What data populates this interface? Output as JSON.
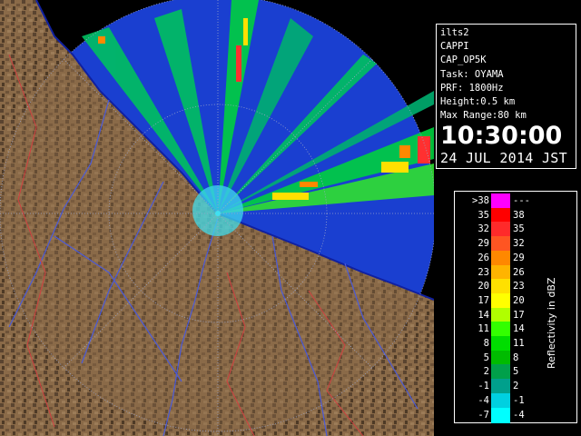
{
  "radar_info": {
    "lines": [
      "ilts2",
      "CAPPI",
      "CAP_OP5K",
      "Task: OYAMA",
      "PRF: 1800Hz",
      "Height:0.5 km",
      "Max Range:80 km"
    ],
    "time": "10:30:00",
    "date": "24 JUL 2014 JST"
  },
  "legend": {
    "title": "Reflectivity in dBZ",
    "rows": [
      {
        "lo": ">38",
        "hi": "---",
        "color": "#ff00ff"
      },
      {
        "lo": "35",
        "hi": "38",
        "color": "#ff0000"
      },
      {
        "lo": "32",
        "hi": "35",
        "color": "#ff2a2a"
      },
      {
        "lo": "29",
        "hi": "32",
        "color": "#ff5522"
      },
      {
        "lo": "26",
        "hi": "29",
        "color": "#ff8800"
      },
      {
        "lo": "23",
        "hi": "26",
        "color": "#ffb400"
      },
      {
        "lo": "20",
        "hi": "23",
        "color": "#ffe000"
      },
      {
        "lo": "17",
        "hi": "20",
        "color": "#ffff00"
      },
      {
        "lo": "14",
        "hi": "17",
        "color": "#b0ff00"
      },
      {
        "lo": "11",
        "hi": "14",
        "color": "#33ff00"
      },
      {
        "lo": "8",
        "hi": "11",
        "color": "#00dd00"
      },
      {
        "lo": "5",
        "hi": "8",
        "color": "#00bb00"
      },
      {
        "lo": "2",
        "hi": "5",
        "color": "#00a04a"
      },
      {
        "lo": "-1",
        "hi": "2",
        "color": "#00a08c"
      },
      {
        "lo": "-4",
        "hi": "-1",
        "color": "#00d0e0"
      },
      {
        "lo": "-7",
        "hi": "-4",
        "color": "#00ffff"
      }
    ]
  },
  "map_colors": {
    "sea": "#1a3fd0",
    "sea_deep": "#0a2cc8",
    "land": "#8a6a48",
    "land_dark": "#4e3a26",
    "grid": "#9aa4c8",
    "river": "#4a5ad8",
    "border": "#d04040",
    "radar_site": "#40e0f0"
  }
}
